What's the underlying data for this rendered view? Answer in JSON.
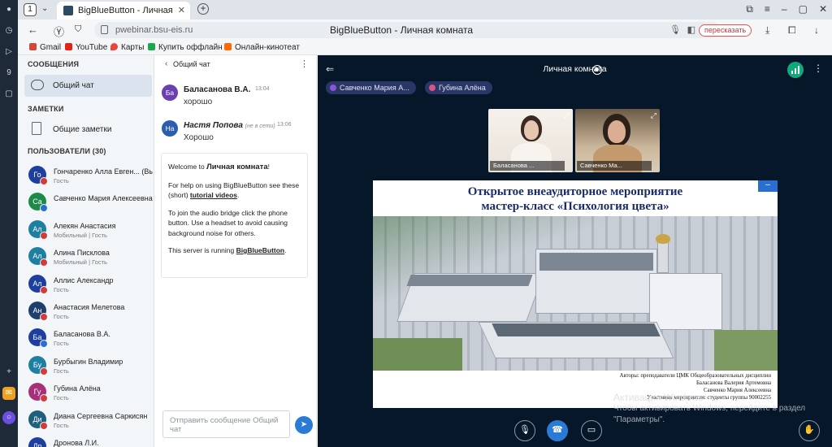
{
  "browser": {
    "tab_count": "1",
    "tab_title": "BigBlueButton - Личная",
    "url": "pwebinar.bsu-eis.ru",
    "page_title": "BigBlueButton - Личная комната",
    "retell_label": "пересказать",
    "bookmarks": [
      "Gmail",
      "YouTube",
      "Карты",
      "Купить оффлайн ...",
      "Онлайн-кинотеат"
    ]
  },
  "sidebar": {
    "messages_header": "СООБЩЕНИЯ",
    "public_chat_label": "Общий чат",
    "notes_header": "ЗАМЕТКИ",
    "shared_notes_label": "Общие заметки",
    "users_header": "ПОЛЬЗОВАТЕЛИ (30)",
    "users": [
      {
        "initials": "Го",
        "name": "Гончаренко Алла Евген... (Вы)",
        "role": "Гость",
        "color": "#1f3f9e",
        "status": "#d13b3b"
      },
      {
        "initials": "Са",
        "name": "Савченко Мария Алексеевна",
        "role": "",
        "color": "#1e8a4a",
        "status": "#2a6fd0"
      },
      {
        "initials": "Ал",
        "name": "Алекян Анастасия",
        "role": "Мобильный | Гость",
        "color": "#1e7fa3",
        "status": "#d13b3b"
      },
      {
        "initials": "Ал",
        "name": "Алина Писклова",
        "role": "Мобильный | Гость",
        "color": "#1e7fa3",
        "status": "#d13b3b"
      },
      {
        "initials": "Ал",
        "name": "Аллис Александр",
        "role": "Гость",
        "color": "#1e3f9e",
        "status": "#d13b3b"
      },
      {
        "initials": "Ан",
        "name": "Анастасия Мелетова",
        "role": "Гость",
        "color": "#1e3f6e",
        "status": "#d13b3b"
      },
      {
        "initials": "Ба",
        "name": "Баласанова В.А.",
        "role": "Гость",
        "color": "#1e3f9e",
        "status": "#2a6fd0"
      },
      {
        "initials": "Бу",
        "name": "Бурбыгин Владимир",
        "role": "Гость",
        "color": "#1e7fa3",
        "status": "#d13b3b"
      },
      {
        "initials": "Гу",
        "name": "Губина Алёна",
        "role": "Гость",
        "color": "#a8307a",
        "status": "#d13b3b"
      },
      {
        "initials": "Ди",
        "name": "Диана Сергеевна Саркисян",
        "role": "Гость",
        "color": "#1e5f7e",
        "status": "#d13b3b"
      },
      {
        "initials": "Др",
        "name": "Дронова Л.И.",
        "role": "",
        "color": "#1e3f9e",
        "status": "#d13b3b"
      }
    ]
  },
  "chat": {
    "title": "Общий чат",
    "messages": [
      {
        "initials": "Ба",
        "name": "Баласанова В.А.",
        "time": "13:04",
        "text": "хорошо",
        "offline": "",
        "color": "#6a3fb0"
      },
      {
        "initials": "На",
        "name": "Настя Попова",
        "time": "13:06",
        "text": "Хорошо",
        "offline": "(не в сети)",
        "color": "#2a5fb0"
      }
    ],
    "welcome": {
      "p1_pre": "Welcome to ",
      "p1_bold": "Личная комната",
      "p1_post": "!",
      "p2_pre": "For help on using BigBlueButton see these (short) ",
      "p2_link": "tutorial videos",
      "p2_post": ".",
      "p3": "To join the audio bridge click the phone button. Use a headset to avoid causing background noise for others.",
      "p4_pre": "This server is running ",
      "p4_link": "BigBlueButton",
      "p4_post": "."
    },
    "input_placeholder": "Отправить сообщение Общий чат"
  },
  "main": {
    "title": "Личная комната",
    "talkers": [
      "Савченко Мария А...",
      "Губина Алёна"
    ],
    "videos": [
      {
        "name": "Баласанова ..."
      },
      {
        "name": "Савченко Ма..."
      }
    ],
    "slide": {
      "title_line1": "Открытое внеаудиторное мероприятие",
      "title_line2": "мастер-класс «Психология цвета»",
      "credits": [
        "Авторы: преподаватели ЦМК Общеобразовательных дисциплин",
        "Баласанова Валерия Артемовна",
        "Савченко Мария Алексеевна",
        "Участники мероприятия: студенты группы 90002255"
      ]
    },
    "watermark_line1": "Активация Windows",
    "watermark_line2": "Чтобы активировать Windows, перейдите в раздел",
    "watermark_line3": "\"Параметры\"."
  }
}
